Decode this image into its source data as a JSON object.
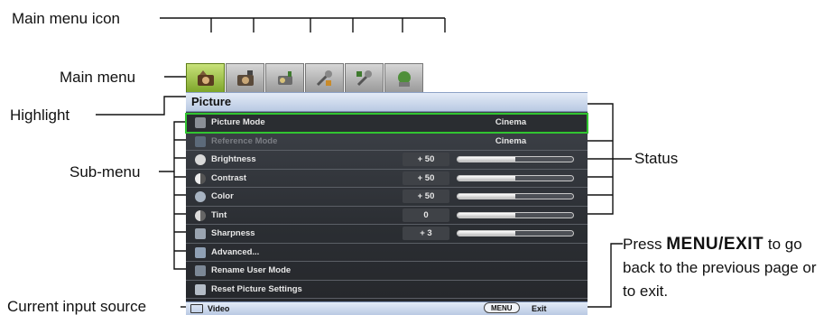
{
  "callouts": {
    "main_menu_icon": "Main menu icon",
    "main_menu": "Main menu",
    "highlight": "Highlight",
    "sub_menu": "Sub-menu",
    "status": "Status",
    "current_input_source": "Current input source",
    "press_prefix": "Press ",
    "press_key": "MENU/EXIT",
    "press_suffix": " to go back to the previous page or to exit."
  },
  "osd": {
    "tabs": [
      {
        "icon": "picture-icon",
        "active": true
      },
      {
        "icon": "picture-advanced-icon",
        "active": false
      },
      {
        "icon": "display-icon",
        "active": false
      },
      {
        "icon": "setup-basic-icon",
        "active": false
      },
      {
        "icon": "setup-advanced-icon",
        "active": false
      },
      {
        "icon": "information-icon",
        "active": false
      }
    ],
    "title": "Picture",
    "items": [
      {
        "label": "Picture Mode",
        "status": "Cinema",
        "icon": "picture-mode-icon"
      },
      {
        "label": "Reference Mode",
        "status": "Cinema",
        "icon": "reference-mode-icon"
      },
      {
        "label": "Brightness",
        "value": "+ 50",
        "level": 0.5,
        "icon": "brightness-icon"
      },
      {
        "label": "Contrast",
        "value": "+ 50",
        "level": 0.5,
        "icon": "contrast-icon"
      },
      {
        "label": "Color",
        "value": "+ 50",
        "level": 0.5,
        "icon": "color-icon"
      },
      {
        "label": "Tint",
        "value": "0",
        "level": 0.5,
        "icon": "tint-icon"
      },
      {
        "label": "Sharpness",
        "value": "+ 3",
        "level": 0.5,
        "icon": "sharpness-icon"
      },
      {
        "label": "Advanced...",
        "icon": "advanced-icon"
      },
      {
        "label": "Rename User Mode",
        "icon": "rename-icon"
      },
      {
        "label": "Reset Picture Settings",
        "icon": "reset-icon"
      }
    ],
    "footer": {
      "source": "Video",
      "menu_key": "MENU",
      "exit": "Exit"
    },
    "colors": {
      "highlight": "#31c531",
      "active_tab": "#8fb53a",
      "body": "#2f3237",
      "title_bar": "#c9d6ec"
    }
  }
}
